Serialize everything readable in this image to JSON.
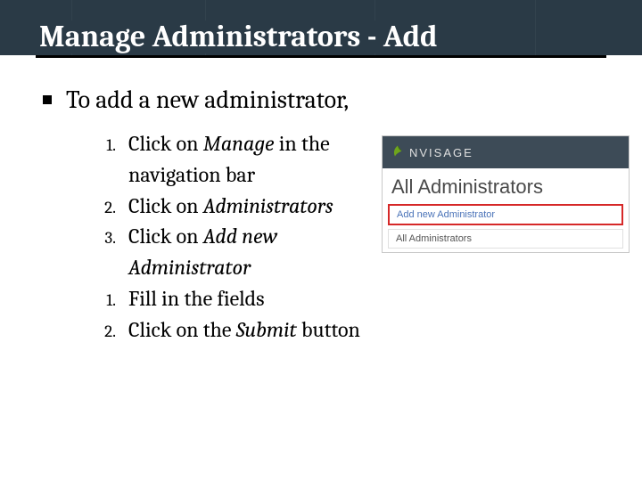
{
  "title": "Manage Administrators - Add",
  "lead": "To add a new administrator,",
  "steps": [
    {
      "num": "1.",
      "pre": "Click on ",
      "em": "Manage",
      "post": " in the navigation bar"
    },
    {
      "num": "2.",
      "pre": "Click on ",
      "em": "Administrators",
      "post": ""
    },
    {
      "num": "3.",
      "pre": "Click on ",
      "em": "Add new Administrator",
      "post": ""
    },
    {
      "num": "1.",
      "pre": "Fill in the fields",
      "em": "",
      "post": ""
    },
    {
      "num": "2.",
      "pre": "Click on the ",
      "em": "Submit",
      "post": " button"
    }
  ],
  "inset": {
    "brand": "NVISAGE",
    "heading": "All Administrators",
    "link_add": "Add new Administrator",
    "link_all": "All Administrators"
  }
}
